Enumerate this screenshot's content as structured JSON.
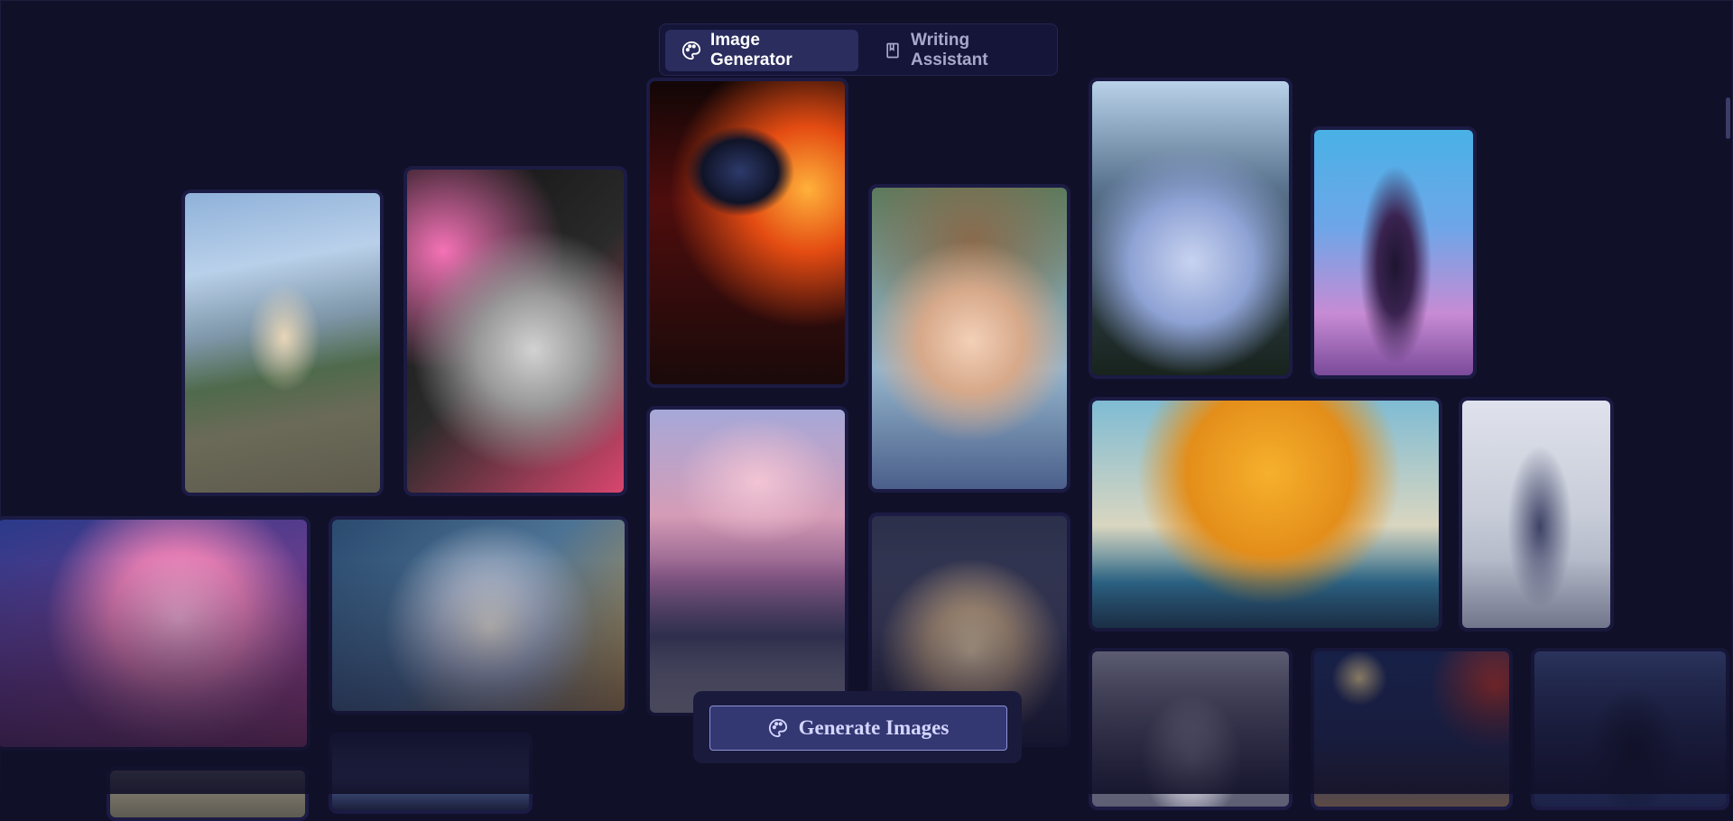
{
  "tabs": [
    {
      "label": "Image Generator",
      "icon": "palette-icon",
      "active": true
    },
    {
      "label": "Writing Assistant",
      "icon": "book-icon",
      "active": false
    }
  ],
  "generate_button": {
    "label": "Generate Images",
    "icon": "palette-icon"
  },
  "colors": {
    "background": "#111029",
    "tab_active": "#2a2d5e",
    "button_fill": "#333772",
    "button_border": "#8e92d6"
  },
  "gallery": [
    {
      "subject": "anime boy on railing by mountains"
    },
    {
      "subject": "anime girl with pink ribbons and green eyes"
    },
    {
      "subject": "masked figure breathing fire"
    },
    {
      "subject": "chibi girl with bear hat"
    },
    {
      "subject": "ruined towers with floating creature"
    },
    {
      "subject": "dark armored figure raising arm"
    },
    {
      "subject": "pink coral reef"
    },
    {
      "subject": "blonde girl in blue forest"
    },
    {
      "subject": "pink clouds over beach"
    },
    {
      "subject": "witch girl with hat"
    },
    {
      "subject": "figure on peak before orange sun"
    },
    {
      "subject": "girl standing in alley"
    },
    {
      "subject": "hooded figure in stone arch"
    },
    {
      "subject": "girl under night moon with red leaves"
    },
    {
      "subject": "hooded reaper with moon"
    }
  ]
}
